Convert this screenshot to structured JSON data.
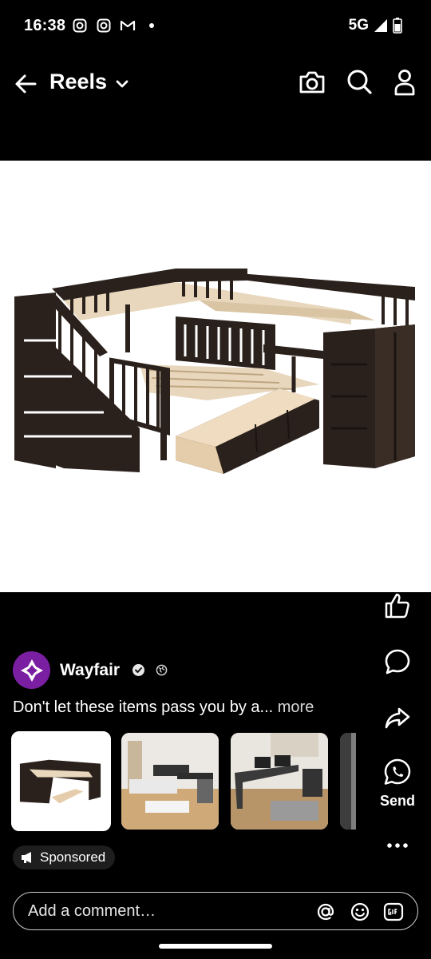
{
  "status_bar": {
    "time": "16:38",
    "notification_icons": [
      "instagram-icon",
      "instagram-icon",
      "gmail-icon",
      "dot-icon"
    ],
    "network": "5G"
  },
  "header": {
    "title": "Reels",
    "icons": [
      "back-arrow-icon",
      "chevron-down-icon",
      "camera-icon",
      "search-icon",
      "profile-icon"
    ]
  },
  "actions": {
    "send_label": "Send",
    "icons": [
      "like-icon",
      "comment-icon",
      "share-icon",
      "whatsapp-icon",
      "more-icon"
    ]
  },
  "author": {
    "name": "Wayfair",
    "verified": true,
    "avatar_color": "#7b1fa2"
  },
  "caption": {
    "text": "Don't let these items pass you by a...",
    "more": "more"
  },
  "products": [
    {
      "name": "L-shaped bunk bed with stairs",
      "selected": true
    },
    {
      "name": "Bed with desk set",
      "selected": false
    },
    {
      "name": "L-shaped gaming desk",
      "selected": false
    },
    {
      "name": "Partial product",
      "selected": false
    }
  ],
  "sponsored": {
    "label": "Sponsored"
  },
  "comment": {
    "placeholder": "Add a comment…",
    "icons": [
      "mention-icon",
      "emoji-icon",
      "gif-icon"
    ]
  }
}
